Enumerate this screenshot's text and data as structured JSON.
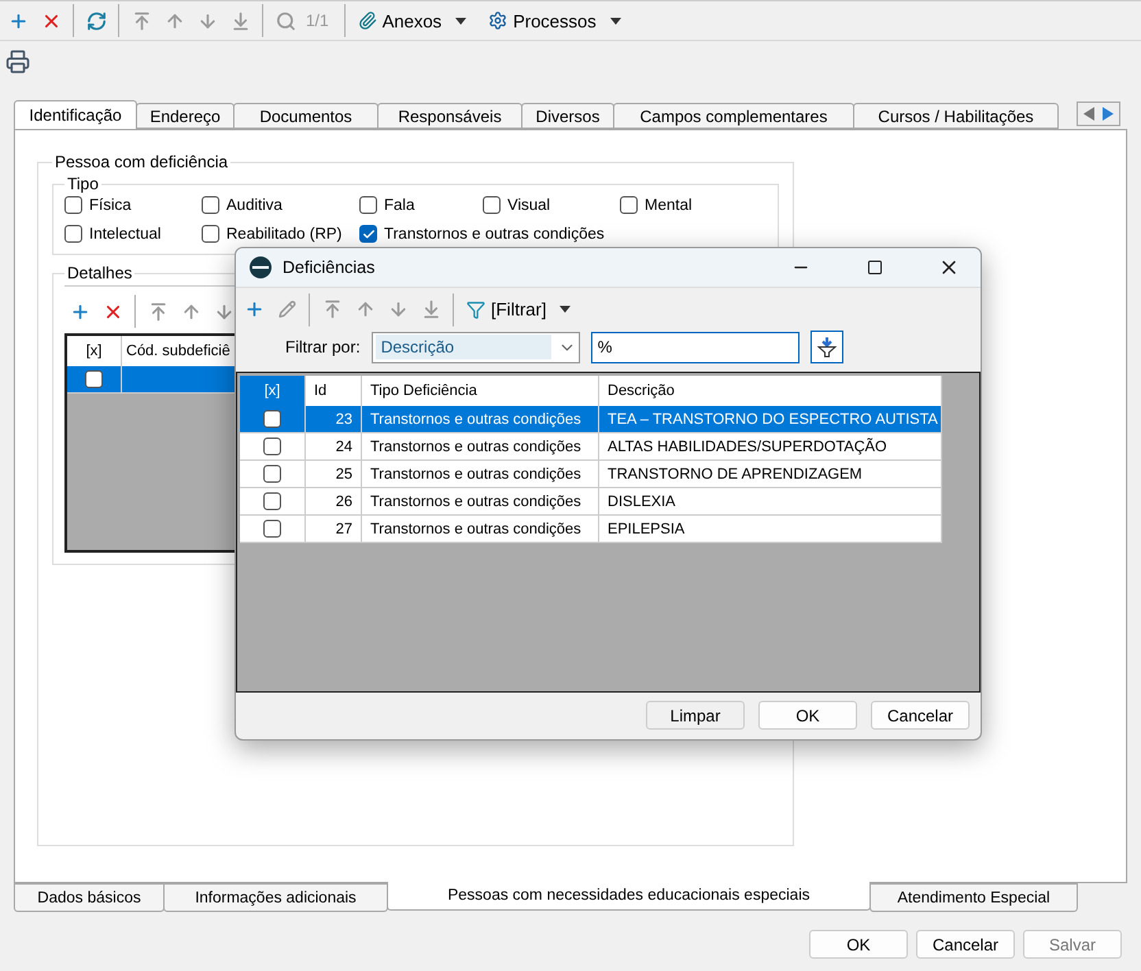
{
  "toolbar": {
    "counter": "1/1",
    "menus": [
      {
        "label": "Anexos",
        "kind": "attach"
      },
      {
        "label": "Processos",
        "kind": "gear"
      }
    ]
  },
  "tabs": [
    {
      "label": "Identificação",
      "selected": true
    },
    {
      "label": "Endereço",
      "selected": false
    },
    {
      "label": "Documentos",
      "selected": false
    },
    {
      "label": "Responsáveis",
      "selected": false
    },
    {
      "label": "Diversos",
      "selected": false
    },
    {
      "label": "Campos complementares",
      "selected": false
    },
    {
      "label": "Cursos / Habilitações",
      "selected": false
    }
  ],
  "person_group": {
    "title": "Pessoa com deficiência",
    "type_group": {
      "title": "Tipo",
      "options": [
        {
          "label": "Física",
          "checked": false
        },
        {
          "label": "Auditiva",
          "checked": false
        },
        {
          "label": "Fala",
          "checked": false
        },
        {
          "label": "Visual",
          "checked": false
        },
        {
          "label": "Mental",
          "checked": false
        },
        {
          "label": "Intelectual",
          "checked": false
        },
        {
          "label": "Reabilitado (RP)",
          "checked": false
        },
        {
          "label": "Transtornos e outras condições",
          "checked": true
        }
      ]
    },
    "details": {
      "title": "Detalhes",
      "columns": [
        "[x]",
        "Cód. subdeficiê"
      ],
      "rows": [
        {
          "checked": false,
          "selected": true
        }
      ]
    }
  },
  "bottom_tabs": [
    {
      "label": "Dados básicos",
      "selected": false
    },
    {
      "label": "Informações adicionais",
      "selected": false
    },
    {
      "label": "Pessoas com necessidades educacionais especiais",
      "selected": true
    },
    {
      "label": "Atendimento Especial",
      "selected": false
    }
  ],
  "buttons": [
    {
      "label": "OK",
      "disabled": false
    },
    {
      "label": "Cancelar",
      "disabled": false
    },
    {
      "label": "Salvar",
      "disabled": true
    }
  ],
  "dialog": {
    "title": "Deficiências",
    "filter_menu": "[Filtrar]",
    "filter": {
      "label": "Filtrar por:",
      "field": "Descrição",
      "value": "%"
    },
    "columns": [
      "[x]",
      "Id",
      "Tipo Deficiência",
      "Descrição"
    ],
    "rows": [
      {
        "checked": false,
        "selected": true,
        "id": "23",
        "type": "Transtornos e outras condições",
        "description": "TEA – TRANSTORNO DO ESPECTRO AUTISTA"
      },
      {
        "checked": false,
        "selected": false,
        "id": "24",
        "type": "Transtornos e outras condições",
        "description": "ALTAS HABILIDADES/SUPERDOTAÇÃO"
      },
      {
        "checked": false,
        "selected": false,
        "id": "25",
        "type": "Transtornos e outras condições",
        "description": "TRANSTORNO DE APRENDIZAGEM"
      },
      {
        "checked": false,
        "selected": false,
        "id": "26",
        "type": "Transtornos e outras condições",
        "description": "DISLEXIA"
      },
      {
        "checked": false,
        "selected": false,
        "id": "27",
        "type": "Transtornos e outras condições",
        "description": "EPILEPSIA"
      }
    ],
    "buttons": [
      {
        "label": "Limpar",
        "selected": true
      },
      {
        "label": "OK",
        "selected": false
      },
      {
        "label": "Cancelar",
        "selected": false
      }
    ]
  }
}
